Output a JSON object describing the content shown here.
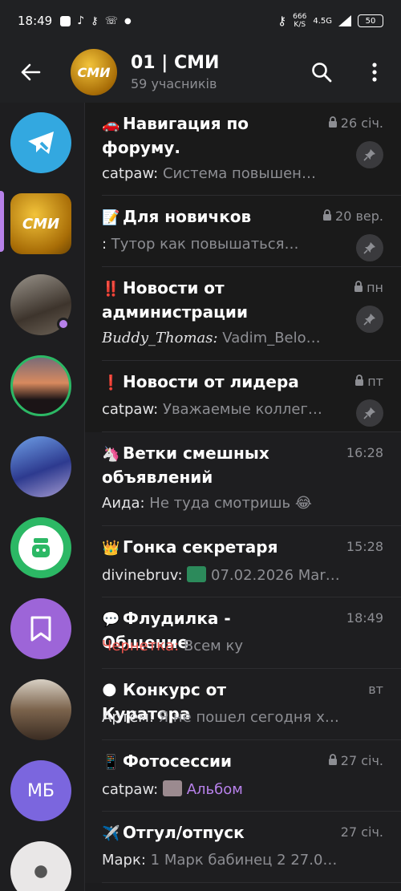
{
  "status": {
    "time": "18:49",
    "net_speed": "666",
    "net_unit": "K/S",
    "signal": "4.5G",
    "battery": "50"
  },
  "header": {
    "title": "01 | СМИ",
    "subtitle": "59 учасників",
    "avatar_text": "СМИ"
  },
  "rail": {
    "items": [
      {
        "name": "settings-bot",
        "color": "#33a8e0"
      },
      {
        "name": "smi-group",
        "color": "#c89317",
        "text": "СМИ",
        "selected": true
      },
      {
        "name": "photo-chat-1",
        "color": "#6a6158"
      },
      {
        "name": "photo-chat-2",
        "color": "#43333a"
      },
      {
        "name": "anime-chat",
        "color": "#3f58a7"
      },
      {
        "name": "bot-chat",
        "color": "#2cb865"
      },
      {
        "name": "saved-messages",
        "color": "#9d65d8"
      },
      {
        "name": "photo-chat-3",
        "color": "#7b634c"
      },
      {
        "name": "mb-chat",
        "color": "#7b66de",
        "text": "МБ"
      },
      {
        "name": "photo-chat-4",
        "color": "#c9c7c7"
      }
    ]
  },
  "topics": [
    {
      "emoji": "🚗",
      "title": "Навигация по форуму.",
      "time": "26 січ.",
      "locked": true,
      "pinned": true,
      "sender": "catpaw:",
      "text": " Система повышен…"
    },
    {
      "emoji": "📝",
      "title": "Для новичков",
      "time": "20 вер.",
      "locked": true,
      "pinned": true,
      "sender": ":",
      "text": " Тутор как повышаться…"
    },
    {
      "emoji": "‼️",
      "title": "Новости от администрации",
      "time": "пн",
      "locked": true,
      "pinned": true,
      "sender": "Buddy_Thomas:",
      "text": " Vadim_Belo…"
    },
    {
      "emoji": "❗",
      "title": "Новости от лидера",
      "time": "пт",
      "locked": true,
      "pinned": true,
      "sender": "catpaw:",
      "text": " Уважаемые коллег…"
    },
    {
      "emoji": "🦄",
      "title": "Ветки смешных объявлений",
      "time": "16:28",
      "locked": false,
      "pinned": false,
      "sender": "Аида:",
      "text": " Не туда смотришь 😂"
    },
    {
      "emoji": "👑",
      "title": "Гонка секретаря",
      "time": "15:28",
      "locked": false,
      "pinned": false,
      "sender": "divinebruv:",
      "text": " 07.02.2026 Martin…"
    },
    {
      "emoji": "💬",
      "title": "Флудилка - Общение",
      "time": "18:49",
      "locked": false,
      "pinned": false,
      "sender": "Чернетка:",
      "text": " Всем ку"
    },
    {
      "emoji": "🌑",
      "title": "Конкурс от Куратора",
      "time": "вт",
      "locked": false,
      "pinned": false,
      "sender": "Артём:",
      "text": " Я не пошел сегодня хах…"
    },
    {
      "emoji": "📱",
      "title": "Фотосессии",
      "time": "27 січ.",
      "locked": true,
      "pinned": false,
      "sender": "catpaw:",
      "text": " Альбом"
    },
    {
      "emoji": "✈️",
      "title": "Отгул/отпуск",
      "time": "27 січ.",
      "locked": false,
      "pinned": false,
      "sender": "Марк:",
      "text": " 1 Марк бабинец 2 27.01…."
    }
  ]
}
